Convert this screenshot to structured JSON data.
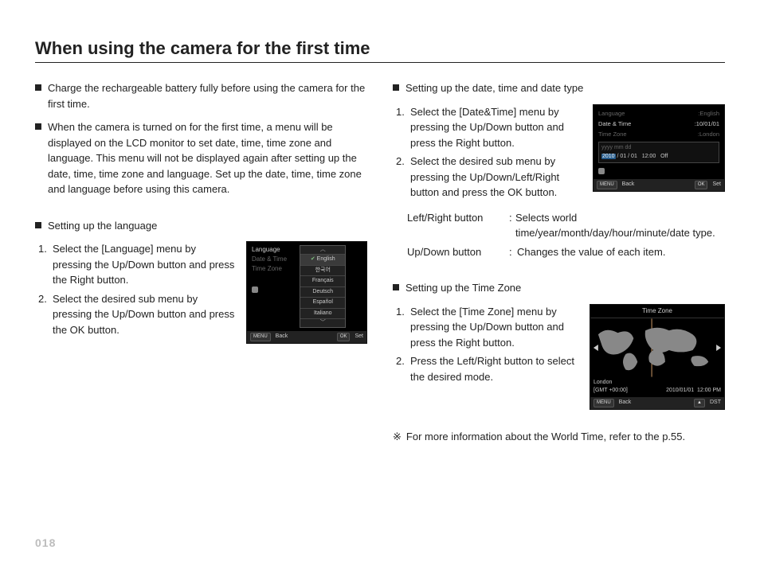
{
  "page": {
    "title": "When using the camera for the first time",
    "number": "018"
  },
  "left": {
    "p1": "Charge the rechargeable battery fully before using the camera for the first time.",
    "p2": "When the camera is turned on for the first time, a menu will be displayed on the LCD monitor to set date, time, time zone and language. This menu will not be displayed again after setting up the date, time, time zone and language. Set up the date, time, time zone and language before using this camera.",
    "lang_head": "Setting up the language",
    "lang_step1": "Select the [Language] menu by pressing the Up/Down button and press the Right button.",
    "lang_step2": "Select the desired sub menu by pressing the Up/Down button and press the OK button."
  },
  "right": {
    "date_head": "Setting up the date, time and date type",
    "date_step1": "Select the [Date&Time] menu by pressing the Up/Down button and press the Right button.",
    "date_step2": "Select the desired sub menu by pressing the Up/Down/Left/Right button and press the OK button.",
    "lr_label": "Left/Right button",
    "lr_desc": "Selects world time/year/month/day/hour/minute/date type.",
    "ud_label": "Up/Down button",
    "ud_desc": "Changes the value of each item.",
    "tz_head": "Setting up the Time Zone",
    "tz_step1": "Select the [Time Zone] menu by pressing the Up/Down button and press the Right button.",
    "tz_step2": "Press the Left/Right button to select the desired mode.",
    "note_mark": "※",
    "note": "For more information about the World Time, refer to the p.55."
  },
  "lcd_common": {
    "menu": "MENU",
    "ok": "OK",
    "back": "Back",
    "set": "Set",
    "dst": "DST"
  },
  "lcd_lang": {
    "menu1": "Language",
    "menu2": "Date & Time",
    "menu3": "Time Zone",
    "opt_en": "English",
    "opt_ko": "한국어",
    "opt_fr": "Français",
    "opt_de": "Deutsch",
    "opt_es": "Español",
    "opt_it": "Italiano"
  },
  "lcd_date": {
    "row1l": "Language",
    "row1r": ":English",
    "row2l": "Date & Time",
    "row2r": ":10/01/01",
    "row3l": "Time Zone",
    "row3r": ":London",
    "fmt": "yyyy mm dd",
    "year": "2010",
    "mon": "/ 01",
    "day": "/ 01",
    "time": "12:00",
    "off": "Off"
  },
  "lcd_tz": {
    "title": "Time Zone",
    "city": "London",
    "gmt": "[GMT +00:00]",
    "date": "2010/01/01",
    "time": "12:00 PM"
  }
}
